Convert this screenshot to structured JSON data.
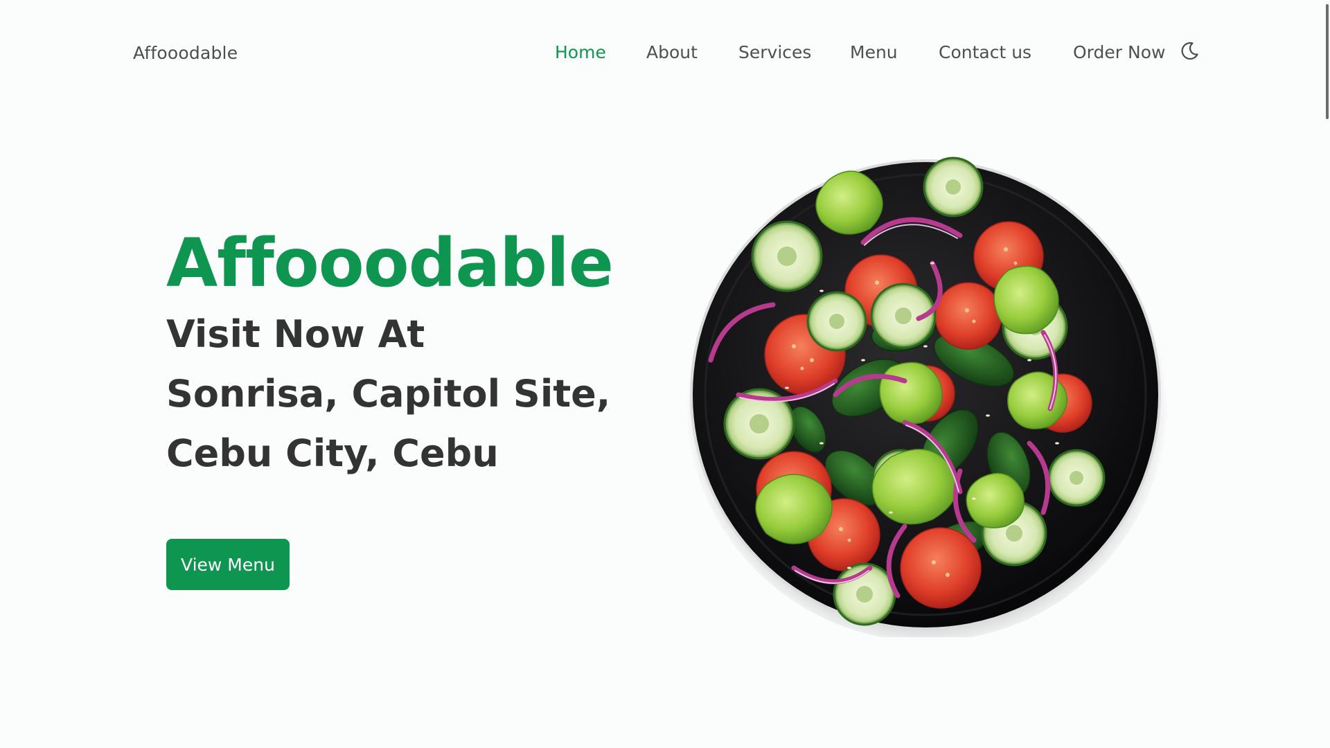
{
  "brand": {
    "name": "Affooodable",
    "accent_color": "#0e9651"
  },
  "nav": {
    "home": "Home",
    "about": "About",
    "services": "Services",
    "menu": "Menu",
    "contact": "Contact us",
    "order": "Order Now",
    "active": "Home",
    "theme_icon": "moon-icon"
  },
  "hero": {
    "title": "Affooodable",
    "subtitle_lines": [
      "Visit Now At",
      "Sonrisa, Capitol Site,",
      "Cebu City, Cebu"
    ],
    "cta_label": "View Menu",
    "image": "salad-plate-image"
  }
}
